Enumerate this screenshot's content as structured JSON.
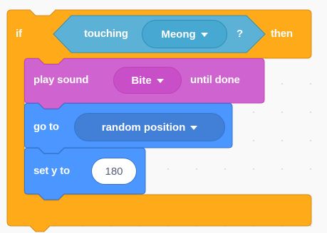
{
  "if_block": {
    "if_label": "if",
    "then_label": "then",
    "condition": {
      "label": "touching",
      "target": "Meong",
      "question_mark": "?"
    }
  },
  "sound_block": {
    "label": "play sound",
    "sound": "Bite",
    "suffix": "until done"
  },
  "goto_block": {
    "label": "go to",
    "target": "random position"
  },
  "sety_block": {
    "label": "set y to",
    "value": "180"
  },
  "colors": {
    "control": "#ffab19",
    "control_border": "#cf8b17",
    "sensing": "#5cb1d6",
    "sensing_border": "#2e8eb8",
    "sensing_dropdown": "#47a8d1",
    "sound": "#cf63cf",
    "sound_border": "#bd42bd",
    "sound_dropdown": "#c94fc9",
    "motion": "#4c97ff",
    "motion_border": "#3373cc",
    "motion_dropdown": "#4280d7"
  }
}
